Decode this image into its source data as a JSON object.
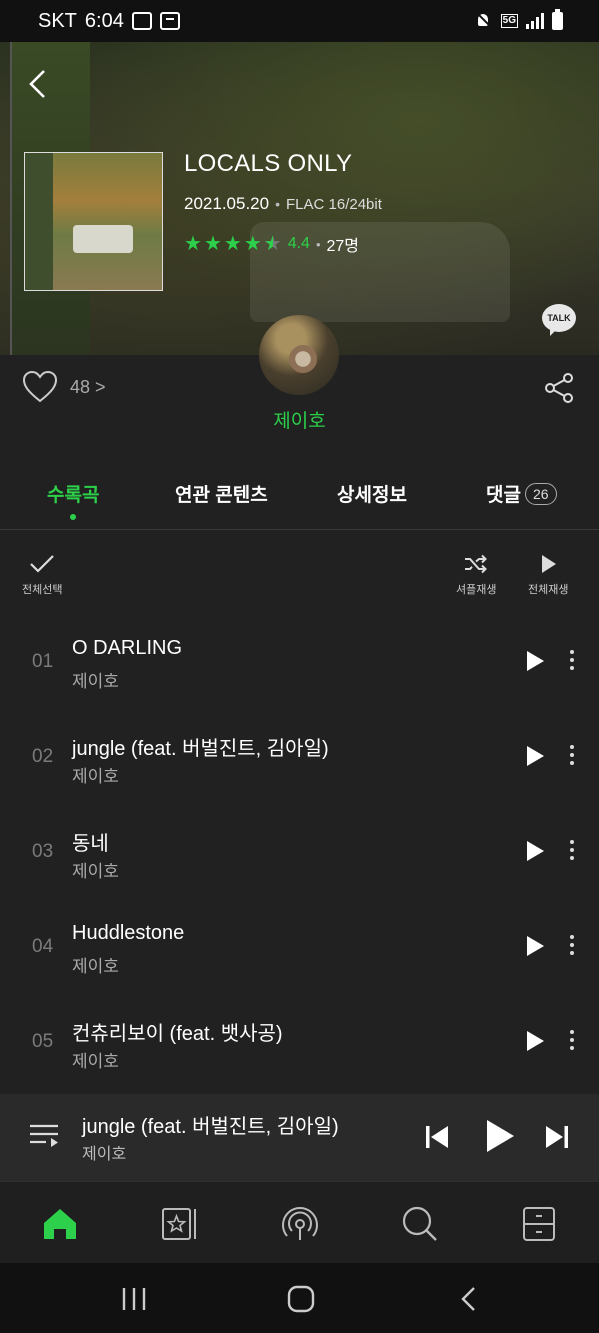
{
  "status_bar": {
    "carrier": "SKT",
    "time": "6:04",
    "network": "5G"
  },
  "album": {
    "title": "LOCALS ONLY",
    "release_date": "2021.05.20",
    "quality": "FLAC 16/24bit",
    "rating": {
      "stars": 4.5,
      "score": "4.4",
      "count": "27명"
    },
    "talk_label": "TALK"
  },
  "like": {
    "count": "48 >"
  },
  "artist": {
    "name": "제이호"
  },
  "tabs": [
    {
      "label": "수록곡",
      "active": true
    },
    {
      "label": "연관 콘텐츠"
    },
    {
      "label": "상세정보"
    },
    {
      "label": "댓글",
      "badge": "26"
    }
  ],
  "actions": {
    "select_all": "전체선택",
    "shuffle_play": "셔플재생",
    "play_all": "전체재생"
  },
  "tracks": [
    {
      "num": "01",
      "title": "O DARLING",
      "artist": "제이호"
    },
    {
      "num": "02",
      "title": "jungle (feat. 버벌진트, 김아일)",
      "artist": "제이호"
    },
    {
      "num": "03",
      "title": "동네",
      "artist": "제이호"
    },
    {
      "num": "04",
      "title": "Huddlestone",
      "artist": "제이호"
    },
    {
      "num": "05",
      "title": "컨츄리보이 (feat. 뱃사공)",
      "artist": "제이호"
    }
  ],
  "mini_player": {
    "title": "jungle (feat. 버벌진트, 김아일)",
    "artist": "제이호"
  },
  "colors": {
    "accent": "#2dd04a",
    "background": "#212121",
    "player": "#2a2a2a"
  },
  "icons": {
    "nav": [
      "home-icon",
      "library-icon",
      "podcast-icon",
      "search-icon",
      "menu-icon"
    ]
  }
}
